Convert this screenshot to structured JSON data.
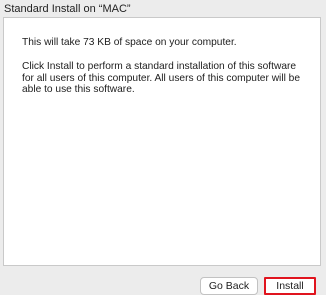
{
  "window": {
    "title": "Standard Install on “MAC”"
  },
  "content": {
    "line_space": "This will take 73 KB of space on your computer.",
    "line_description": "Click Install to perform a standard installation of this software for all users of this computer. All users of this computer will be able to use this software."
  },
  "buttons": {
    "go_back_label": "Go Back",
    "install_label": "Install"
  },
  "colors": {
    "highlight_border": "#e0141e"
  }
}
